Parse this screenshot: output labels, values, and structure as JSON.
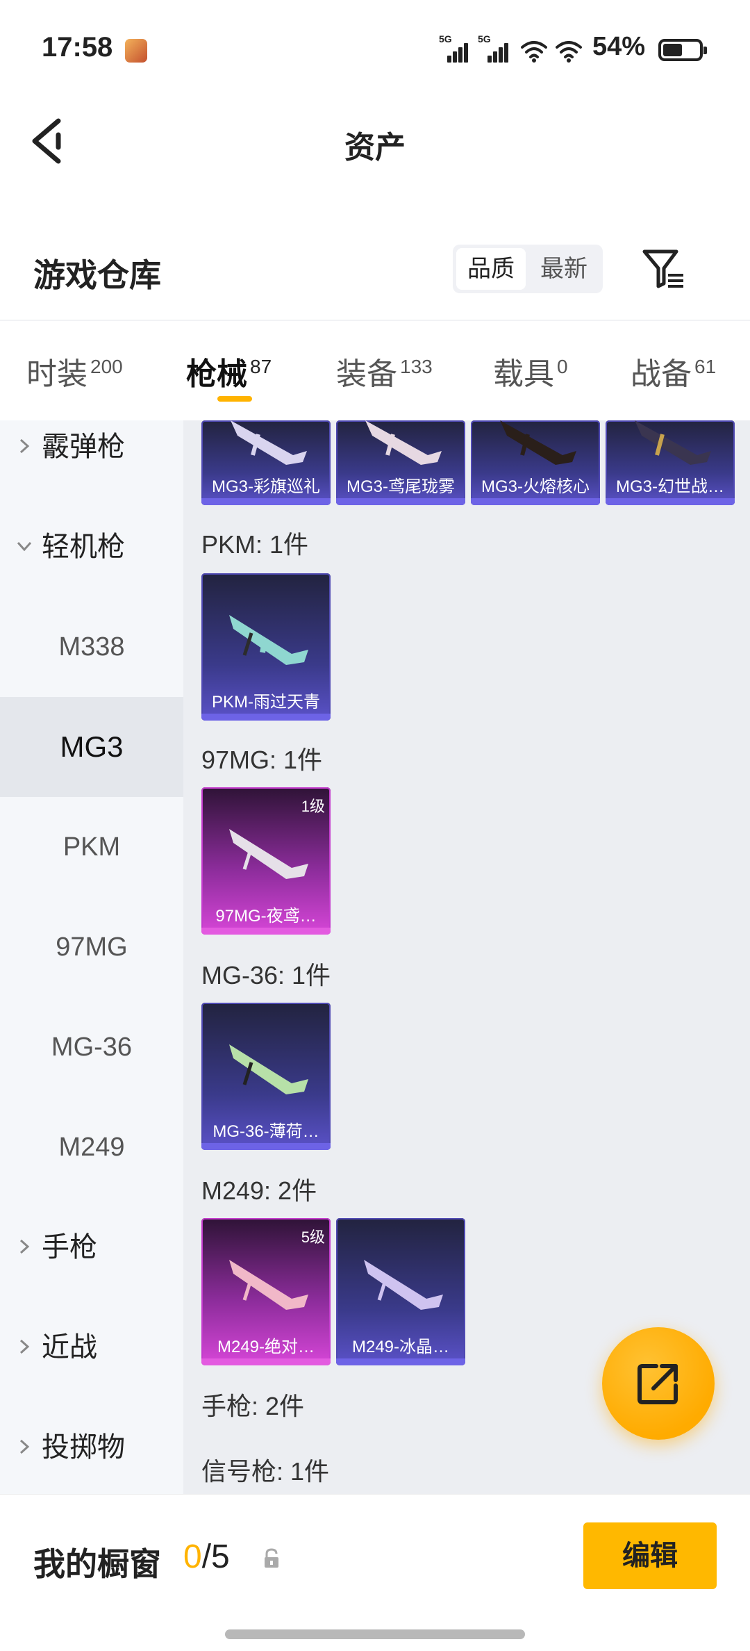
{
  "status_bar": {
    "time": "17:58",
    "signal_1_label": "5G",
    "signal_2_label": "5G",
    "battery_pct": "54%",
    "battery_level": 0.54,
    "icons": [
      "app-badge-icon",
      "signal-icon",
      "wifi-icon",
      "battery-icon"
    ]
  },
  "header": {
    "title": "资产",
    "back_icon": "chevron-left-icon"
  },
  "warehouse": {
    "title": "游戏仓库",
    "sort_options": [
      "品质",
      "最新"
    ],
    "sort_selected": "品质",
    "filter_icon": "filter-icon"
  },
  "tabs": [
    {
      "label": "时装",
      "count": "200"
    },
    {
      "label": "枪械",
      "count": "87"
    },
    {
      "label": "装备",
      "count": "133"
    },
    {
      "label": "载具",
      "count": "0"
    },
    {
      "label": "战备",
      "count": "61"
    }
  ],
  "active_tab": "枪械",
  "sidebar": {
    "groups": [
      {
        "label": "霰弹枪",
        "expanded": false
      },
      {
        "label": "轻机枪",
        "expanded": true
      },
      {
        "label": "手枪",
        "expanded": false
      },
      {
        "label": "近战",
        "expanded": false
      },
      {
        "label": "投掷物",
        "expanded": false
      }
    ],
    "sub_items": [
      "M338",
      "MG3",
      "PKM",
      "97MG",
      "MG-36",
      "M249"
    ],
    "active_sub": "MG3"
  },
  "content": {
    "top_cards": [
      {
        "name": "MG3-彩旗巡礼",
        "rarity": "blue"
      },
      {
        "name": "MG3-鸢尾珑雾",
        "rarity": "blue"
      },
      {
        "name": "MG3-火熔核心",
        "rarity": "blue"
      },
      {
        "name": "MG3-幻世战…",
        "rarity": "blue"
      }
    ],
    "groups": [
      {
        "heading": "PKM: 1件",
        "cards": [
          {
            "name": "PKM-雨过天青",
            "rarity": "blue",
            "level": ""
          }
        ]
      },
      {
        "heading": "97MG: 1件",
        "cards": [
          {
            "name": "97MG-夜鸢…",
            "rarity": "pink",
            "level": "1级"
          }
        ]
      },
      {
        "heading": "MG-36: 1件",
        "cards": [
          {
            "name": "MG-36-薄荷…",
            "rarity": "blue",
            "level": ""
          }
        ]
      },
      {
        "heading": "M249: 2件",
        "cards": [
          {
            "name": "M249-绝对…",
            "rarity": "pink",
            "level": "5级"
          },
          {
            "name": "M249-冰晶…",
            "rarity": "blue",
            "level": ""
          }
        ]
      },
      {
        "heading": "手枪: 2件",
        "cards": []
      },
      {
        "heading": "信号枪: 1件",
        "cards": []
      }
    ]
  },
  "fab": {
    "icon": "share-external-icon"
  },
  "bottom_bar": {
    "label": "我的橱窗",
    "count_current": "0",
    "count_total": "/5",
    "lock_icon": "lock-icon",
    "edit_label": "编辑"
  },
  "colors": {
    "accent": "#ffb300",
    "rarity_blue": "#5b52c9",
    "rarity_pink": "#d746d8",
    "content_bg": "#eceef2",
    "sidebar_bg": "#f5f7fa"
  }
}
